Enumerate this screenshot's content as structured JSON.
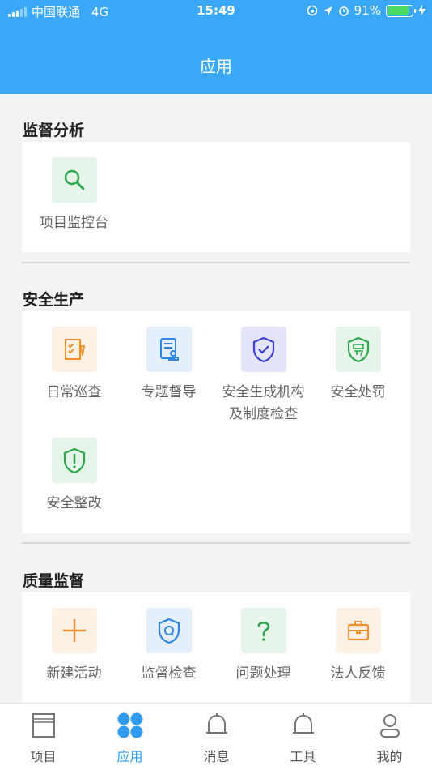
{
  "status_bar": {
    "carrier": "中国联通",
    "network": "4G",
    "time": "15:49",
    "battery": "91%"
  },
  "header": {
    "title": "应用"
  },
  "sections": [
    {
      "title": "监督分析",
      "apps": [
        {
          "label": "项目监控台",
          "icon": "search-icon"
        }
      ]
    },
    {
      "title": "安全生产",
      "apps": [
        {
          "label": "日常巡查",
          "icon": "checklist-icon"
        },
        {
          "label": "专题督导",
          "icon": "document-stamp-icon"
        },
        {
          "label": "安全生成机构及制度检查",
          "icon": "shield-check-icon"
        },
        {
          "label": "安全处罚",
          "icon": "shield-penalty-icon"
        },
        {
          "label": "安全整改",
          "icon": "shield-warning-icon"
        }
      ]
    },
    {
      "title": "质量监督",
      "apps": [
        {
          "label": "新建活动",
          "icon": "plus-icon"
        },
        {
          "label": "监督检查",
          "icon": "shield-q-icon"
        },
        {
          "label": "问题处理",
          "icon": "question-icon"
        },
        {
          "label": "法人反馈",
          "icon": "briefcase-icon"
        }
      ]
    }
  ],
  "tabbar": [
    {
      "label": "项目",
      "icon": "project-icon",
      "active": false
    },
    {
      "label": "应用",
      "icon": "apps-grid-icon",
      "active": true
    },
    {
      "label": "消息",
      "icon": "bell-icon",
      "active": false
    },
    {
      "label": "工具",
      "icon": "tools-bell-icon",
      "active": false
    },
    {
      "label": "我的",
      "icon": "user-icon",
      "active": false
    }
  ],
  "colors": {
    "primary": "#3aa7f8",
    "tab_active": "#2f9bf2",
    "green": "#2aa84a",
    "orange": "#f0902a",
    "blue": "#2f86e0",
    "indigo": "#3b3fd8"
  }
}
